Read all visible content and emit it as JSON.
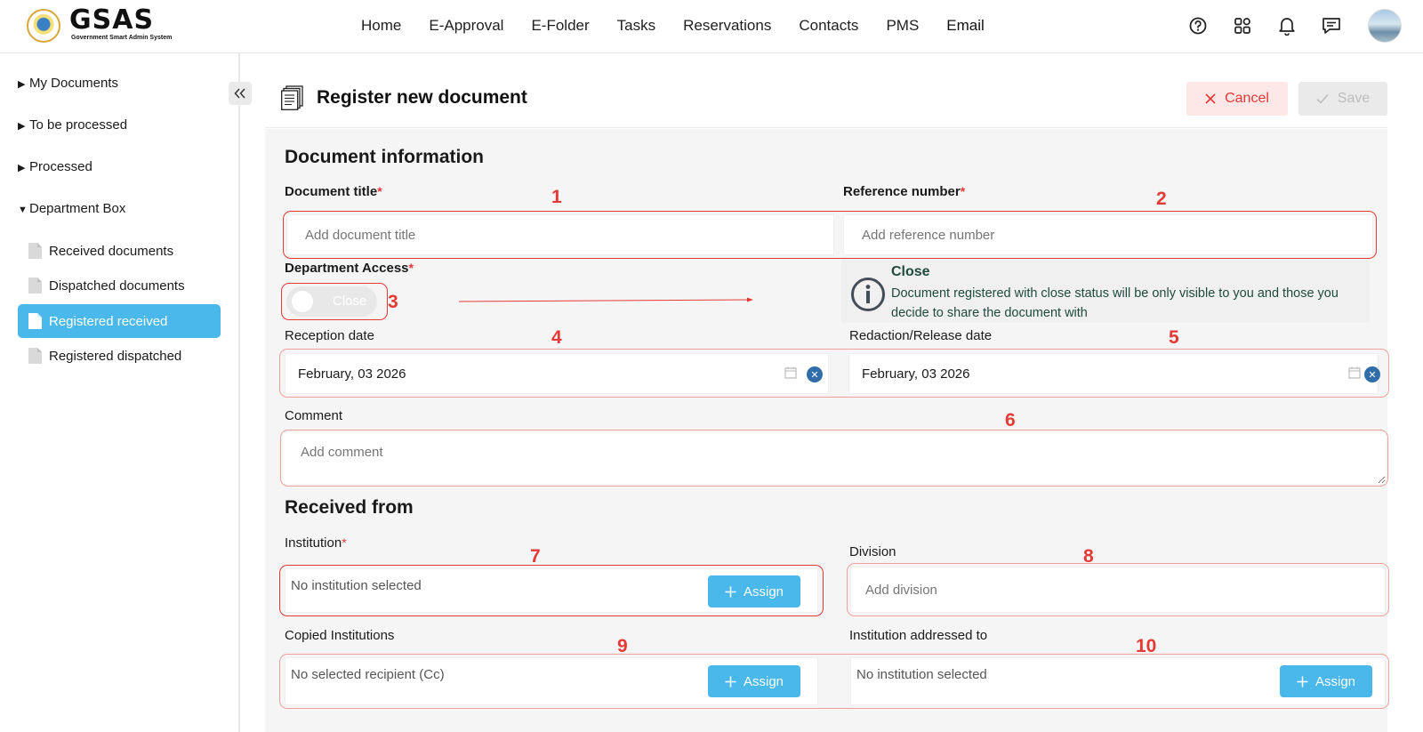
{
  "app": {
    "logo_text": "GSAS",
    "logo_subtitle": "Government Smart Admin System"
  },
  "nav": {
    "items": [
      "Home",
      "E-Approval",
      "E-Folder",
      "Tasks",
      "Reservations",
      "Contacts",
      "PMS",
      "Email"
    ]
  },
  "top_icons": [
    "help-icon",
    "apps-grid-icon",
    "bell-icon",
    "chat-icon"
  ],
  "sidebar": {
    "groups": [
      {
        "label": "My Documents",
        "expanded": false
      },
      {
        "label": "To be processed",
        "expanded": false
      },
      {
        "label": "Processed",
        "expanded": false
      },
      {
        "label": "Department Box",
        "expanded": true
      }
    ],
    "items": [
      {
        "label": "Received documents",
        "active": false
      },
      {
        "label": "Dispatched documents",
        "active": false
      },
      {
        "label": "Registered received",
        "active": true
      },
      {
        "label": "Registered dispatched",
        "active": false
      }
    ]
  },
  "header": {
    "title": "Register new document",
    "cancel_label": "Cancel",
    "save_label": "Save"
  },
  "form": {
    "section_document": "Document information",
    "document_title": {
      "label": "Document title",
      "required_mark": "*",
      "placeholder": "Add document title",
      "value": ""
    },
    "reference_number": {
      "label": "Reference number",
      "required_mark": "*",
      "placeholder": "Add reference number",
      "value": ""
    },
    "department_access": {
      "label": "Department Access",
      "required_mark": "*",
      "toggle_text": "Close",
      "on": false
    },
    "access_info": {
      "title": "Close",
      "text": "Document registered with close status will be only visible to you and those you decide to share the document with"
    },
    "reception_date": {
      "label": "Reception date",
      "value": "February, 03 2026"
    },
    "release_date": {
      "label": "Redaction/Release date",
      "value": "February, 03 2026"
    },
    "comment": {
      "label": "Comment",
      "placeholder": "Add comment"
    },
    "section_received": "Received from",
    "institution": {
      "label": "Institution",
      "required_mark": "*",
      "empty_text": "No institution selected",
      "assign_label": "Assign"
    },
    "division": {
      "label": "Division",
      "placeholder": "Add division"
    },
    "copied_institutions": {
      "label": "Copied Institutions",
      "empty_text": "No selected recipient (Cc)",
      "assign_label": "Assign"
    },
    "addressed_to": {
      "label": "Institution addressed to",
      "empty_text": "No institution selected",
      "assign_label": "Assign"
    }
  },
  "annotations": [
    "1",
    "2",
    "3",
    "4",
    "5",
    "6",
    "7",
    "8",
    "9",
    "10"
  ],
  "colors": {
    "accent": "#4ab8ea",
    "annotation_red": "#e53935",
    "cancel_bg": "#fde7e7",
    "info_text": "#1f4a3e",
    "form_bg": "#f5f5f5"
  }
}
